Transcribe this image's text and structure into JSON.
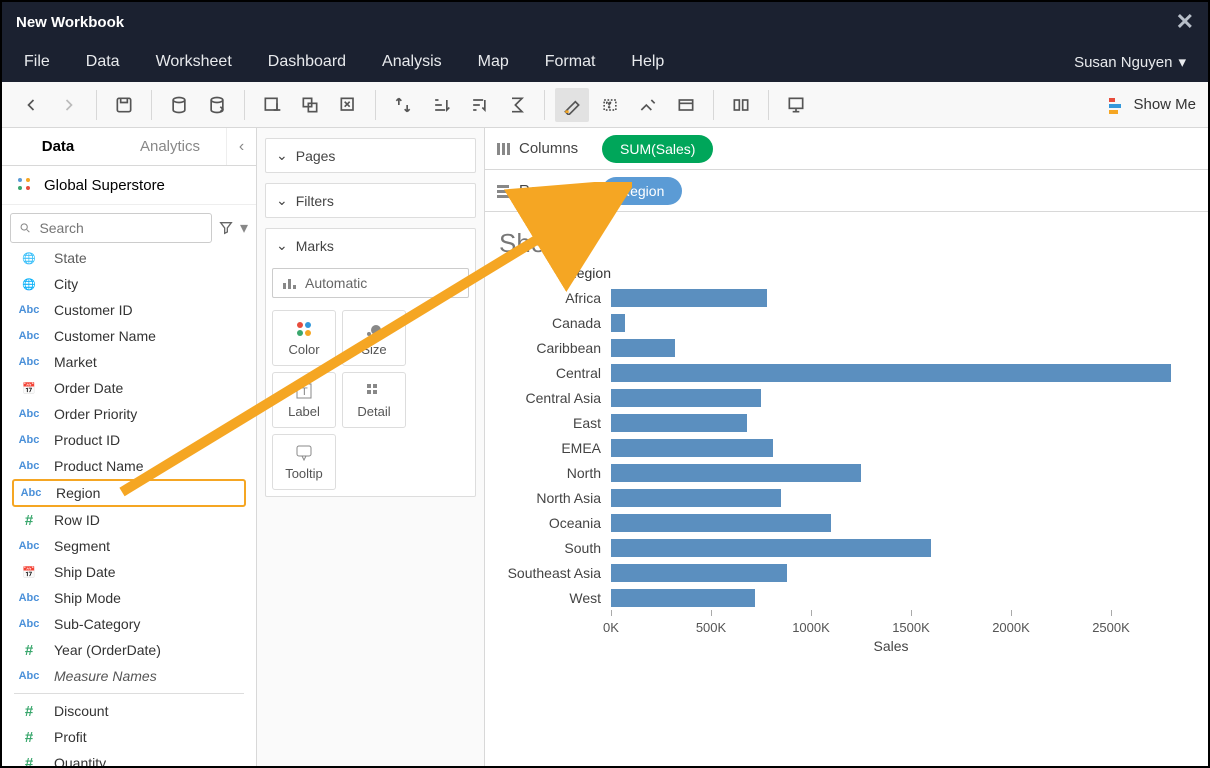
{
  "titlebar": {
    "title": "New Workbook"
  },
  "menubar": {
    "items": [
      "File",
      "Data",
      "Worksheet",
      "Dashboard",
      "Analysis",
      "Map",
      "Format",
      "Help"
    ],
    "user": "Susan Nguyen"
  },
  "toolbar": {
    "showme": "Show Me"
  },
  "left": {
    "tabs": {
      "data": "Data",
      "analytics": "Analytics"
    },
    "datasource": "Global Superstore",
    "search_placeholder": "Search",
    "fields": [
      {
        "type": "globe",
        "label": "State",
        "partial": true
      },
      {
        "type": "globe",
        "label": "City"
      },
      {
        "type": "abc",
        "label": "Customer ID"
      },
      {
        "type": "abc",
        "label": "Customer Name"
      },
      {
        "type": "abc",
        "label": "Market"
      },
      {
        "type": "cal",
        "label": "Order Date"
      },
      {
        "type": "abc",
        "label": "Order Priority"
      },
      {
        "type": "abc",
        "label": "Product ID"
      },
      {
        "type": "abc",
        "label": "Product Name"
      },
      {
        "type": "abc",
        "label": "Region",
        "hl": true
      },
      {
        "type": "hash",
        "label": "Row ID"
      },
      {
        "type": "abc",
        "label": "Segment"
      },
      {
        "type": "cal",
        "label": "Ship Date"
      },
      {
        "type": "abc",
        "label": "Ship Mode"
      },
      {
        "type": "abc",
        "label": "Sub-Category"
      },
      {
        "type": "hash",
        "label": "Year (OrderDate)"
      },
      {
        "type": "abc",
        "label": "Measure Names",
        "italic": true
      },
      {
        "type": "hr"
      },
      {
        "type": "hash",
        "label": "Discount"
      },
      {
        "type": "hash",
        "label": "Profit"
      },
      {
        "type": "hash",
        "label": "Quantity"
      }
    ]
  },
  "mid": {
    "pages": "Pages",
    "filters": "Filters",
    "marks": "Marks",
    "marktype": "Automatic",
    "markbtns": {
      "color": "Color",
      "size": "Size",
      "label": "Label",
      "detail": "Detail",
      "tooltip": "Tooltip"
    }
  },
  "shelves": {
    "columns": "Columns",
    "rows": "Rows",
    "col_pill": "SUM(Sales)",
    "row_pill": "Region"
  },
  "sheet": {
    "title": "Sheet 1",
    "axis_header": "Region",
    "x_label": "Sales",
    "ticks": [
      "0K",
      "500K",
      "1000K",
      "1500K",
      "2000K",
      "2500K"
    ]
  },
  "chart_data": {
    "type": "bar",
    "orientation": "horizontal",
    "xlabel": "Sales",
    "ylabel": "Region",
    "xlim": [
      0,
      2800000
    ],
    "ticks": [
      0,
      500000,
      1000000,
      1500000,
      2000000,
      2500000
    ],
    "categories": [
      "Africa",
      "Canada",
      "Caribbean",
      "Central",
      "Central Asia",
      "East",
      "EMEA",
      "North",
      "North Asia",
      "Oceania",
      "South",
      "Southeast Asia",
      "West"
    ],
    "values": [
      780000,
      70000,
      320000,
      2800000,
      750000,
      680000,
      810000,
      1250000,
      850000,
      1100000,
      1600000,
      880000,
      720000
    ]
  }
}
